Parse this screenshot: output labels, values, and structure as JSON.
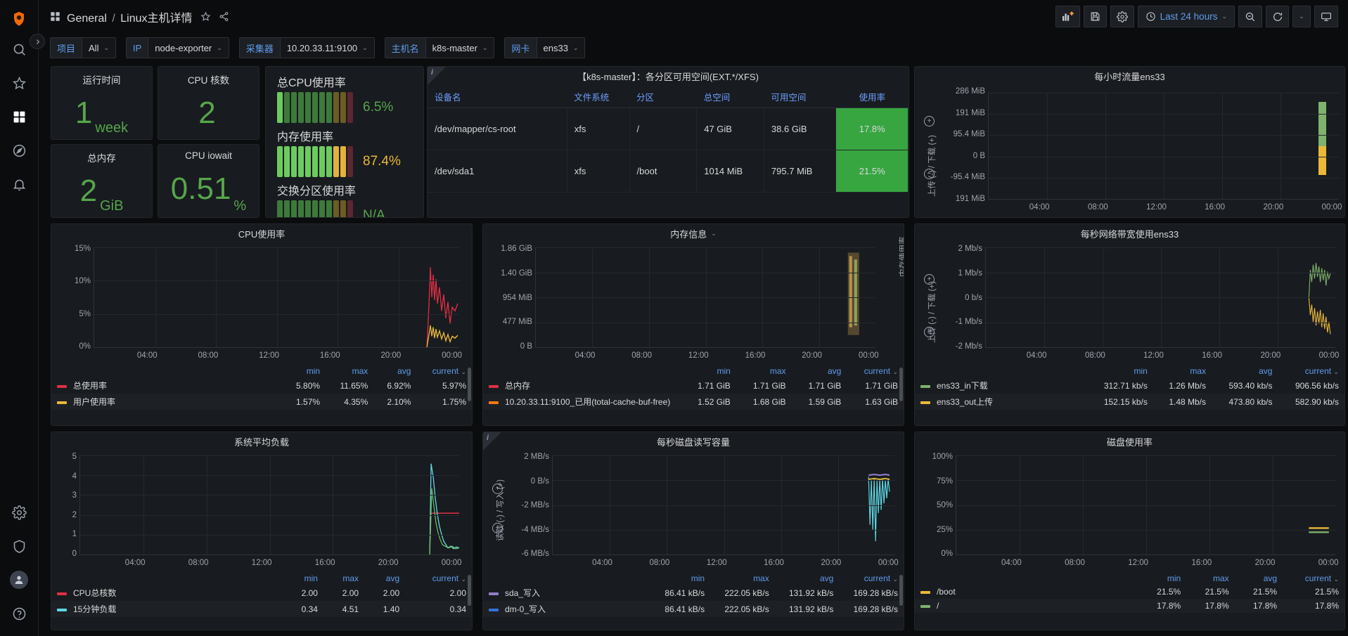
{
  "sidebar": {
    "logo_icon": "grafana-logo-icon",
    "expander_icon": "chevron-right-icon",
    "items": [
      {
        "name": "search-icon",
        "label": "Search"
      },
      {
        "name": "star-icon",
        "label": "Starred"
      },
      {
        "name": "dashboards-icon",
        "label": "Dashboards"
      },
      {
        "name": "compass-icon",
        "label": "Explore"
      },
      {
        "name": "bell-icon",
        "label": "Alerting"
      }
    ],
    "bottom_items": [
      {
        "name": "gear-icon",
        "label": "Configuration"
      },
      {
        "name": "shield-icon",
        "label": "Server Admin"
      },
      {
        "name": "avatar-icon",
        "label": "Profile"
      },
      {
        "name": "help-icon",
        "label": "Help"
      }
    ]
  },
  "topbar": {
    "dashboard_icon": "dashboard-grid-icon",
    "folder": "General",
    "separator": "/",
    "title": "Linux主机详情",
    "star_icon": "star-outline-icon",
    "share_icon": "share-nodes-icon",
    "actions": [
      {
        "name": "add-panel-button",
        "icon": "add-panel-icon"
      },
      {
        "name": "save-dashboard-button",
        "icon": "save-disk-icon"
      },
      {
        "name": "dashboard-settings-button",
        "icon": "gear-icon"
      }
    ],
    "time_picker": {
      "icon": "clock-icon",
      "label": "Last 24 hours",
      "caret": "⌄"
    },
    "zoom_out": {
      "name": "zoom-out-button",
      "icon": "magnifier-minus-icon"
    },
    "refresh": {
      "name": "refresh-button",
      "icon": "refresh-icon",
      "caret": "⌄"
    },
    "tv_mode": {
      "name": "tv-mode-button",
      "icon": "monitor-icon"
    }
  },
  "variables": [
    {
      "label": "项目",
      "value": "All",
      "caret": "⌄"
    },
    {
      "label": "IP",
      "value": "node-exporter",
      "caret": "⌄"
    },
    {
      "label": "采集器",
      "value": "10.20.33.11:9100",
      "caret": "⌄"
    },
    {
      "label": "主机名",
      "value": "k8s-master",
      "caret": "⌄"
    },
    {
      "label": "网卡",
      "value": "ens33",
      "caret": "⌄"
    }
  ],
  "stats": [
    {
      "title": "运行时间",
      "value": "1",
      "unit": "week",
      "color": "#56a64b"
    },
    {
      "title": "CPU 核数",
      "value": "2",
      "unit": "",
      "color": "#56a64b"
    },
    {
      "title": "总内存",
      "value": "2",
      "unit": "GiB",
      "color": "#56a64b"
    },
    {
      "title": "CPU iowait",
      "value": "0.51",
      "unit": "%",
      "color": "#56a64b"
    }
  ],
  "bargauges": {
    "rows": [
      {
        "label": "总CPU使用率",
        "value": "6.5%",
        "value_color": "#56a64b",
        "filled": 1,
        "total": 11
      },
      {
        "label": "内存使用率",
        "value": "87.4%",
        "value_color": "#eab839",
        "filled": 10,
        "total": 11
      },
      {
        "label": "交换分区使用率",
        "value": "N/A",
        "value_color": "#56a64b",
        "filled": 0,
        "total": 11
      }
    ]
  },
  "disk_table": {
    "title": "【k8s-master】：各分区可用空间(EXT.*/XFS)",
    "info_icon": "info-icon",
    "columns": [
      "设备名",
      "文件系统",
      "分区",
      "总空间",
      "可用空间",
      "使用率"
    ],
    "rows": [
      {
        "device": "/dev/mapper/cs-root",
        "fs": "xfs",
        "mount": "/",
        "total": "47 GiB",
        "avail": "38.6 GiB",
        "avail_state": "ok",
        "usage": "17.8%"
      },
      {
        "device": "/dev/sda1",
        "fs": "xfs",
        "mount": "/boot",
        "total": "1014 MiB",
        "avail": "795.7 MiB",
        "avail_state": "crit",
        "usage": "21.5%"
      }
    ]
  },
  "panels": {
    "cpu_usage": {
      "title": "CPU使用率",
      "y_ticks": [
        "15%",
        "10%",
        "5%",
        "0%"
      ],
      "x_ticks": [
        "04:00",
        "08:00",
        "12:00",
        "16:00",
        "20:00",
        "00:00"
      ],
      "legend_headers": [
        "min",
        "max",
        "avg",
        "current"
      ],
      "legend_sort_caret": "⌄",
      "series": [
        {
          "name": "总使用率",
          "color": "#e02f44",
          "min": "5.80%",
          "max": "11.65%",
          "avg": "6.92%",
          "current": "5.97%"
        },
        {
          "name": "用户使用率",
          "color": "#eab839",
          "min": "1.57%",
          "max": "4.35%",
          "avg": "2.10%",
          "current": "1.75%"
        }
      ]
    },
    "memory_info": {
      "title": "内存信息",
      "menu_caret": "⌄",
      "y_ticks": [
        "1.86 GiB",
        "1.40 GiB",
        "954 MiB",
        "477 MiB",
        "0 B"
      ],
      "x_ticks": [
        "04:00",
        "08:00",
        "12:00",
        "16:00",
        "20:00",
        "00:00"
      ],
      "right_label": "内存使用率",
      "legend_headers": [
        "min",
        "max",
        "avg",
        "current"
      ],
      "legend_sort_caret": "⌄",
      "series": [
        {
          "name": "总内存",
          "color": "#e02f44",
          "min": "1.71 GiB",
          "max": "1.71 GiB",
          "avg": "1.71 GiB",
          "current": "1.71 GiB"
        },
        {
          "name": "10.20.33.11:9100_已用(total-cache-buf-free)",
          "color": "#ff780a",
          "min": "1.52 GiB",
          "max": "1.68 GiB",
          "avg": "1.59 GiB",
          "current": "1.63 GiB"
        }
      ]
    },
    "hourly_traffic": {
      "title": "每小时流量ens33",
      "y_ticks": [
        "286 MiB",
        "191 MiB",
        "95.4 MiB",
        "0 B",
        "-95.4 MiB",
        "191 MiB"
      ],
      "x_ticks": [
        "04:00",
        "08:00",
        "12:00",
        "16:00",
        "20:00",
        "00:00"
      ],
      "y_axis_label": "上传 (-) / 下载 (+)",
      "bars": [
        {
          "up": "green",
          "down": "orange"
        }
      ]
    },
    "net_bandwidth": {
      "title": "每秒网络带宽使用ens33",
      "y_ticks": [
        "2 Mb/s",
        "1 Mb/s",
        "0 b/s",
        "-1 Mb/s",
        "-2 Mb/s"
      ],
      "x_ticks": [
        "04:00",
        "08:00",
        "12:00",
        "16:00",
        "20:00",
        "00:00"
      ],
      "y_axis_label": "上传 (-) / 下载 (+)",
      "legend_headers": [
        "min",
        "max",
        "avg",
        "current"
      ],
      "legend_sort_caret": "⌄",
      "series": [
        {
          "name": "ens33_in下载",
          "color": "#7eb26d",
          "min": "312.71 kb/s",
          "max": "1.26 Mb/s",
          "avg": "593.40 kb/s",
          "current": "906.56 kb/s"
        },
        {
          "name": "ens33_out上传",
          "color": "#eab839",
          "min": "152.15 kb/s",
          "max": "1.48 Mb/s",
          "avg": "473.80 kb/s",
          "current": "582.90 kb/s"
        }
      ]
    },
    "load_average": {
      "title": "系统平均负载",
      "y_ticks": [
        "5",
        "4",
        "3",
        "2",
        "1",
        "0"
      ],
      "x_ticks": [
        "04:00",
        "08:00",
        "12:00",
        "16:00",
        "20:00",
        "00:00"
      ],
      "legend_headers": [
        "min",
        "max",
        "avg",
        "current"
      ],
      "legend_sort_caret": "⌄",
      "series": [
        {
          "name": "CPU总核数",
          "color": "#e02f44",
          "min": "2.00",
          "max": "2.00",
          "avg": "2.00",
          "current": "2.00"
        },
        {
          "name": "15分钟负载",
          "color": "#5fd7e4",
          "min": "0.34",
          "max": "4.51",
          "avg": "1.40",
          "current": "0.34"
        }
      ]
    },
    "disk_io": {
      "title": "每秒磁盘读写容量",
      "info_icon": "info-icon",
      "y_ticks": [
        "2 MB/s",
        "0 B/s",
        "-2 MB/s",
        "-4 MB/s",
        "-6 MB/s"
      ],
      "x_ticks": [
        "04:00",
        "08:00",
        "12:00",
        "16:00",
        "20:00",
        "00:00"
      ],
      "y_axis_label": "读取 (-) / 写入 (+)",
      "legend_headers": [
        "min",
        "max",
        "avg",
        "current"
      ],
      "legend_sort_caret": "⌄",
      "series": [
        {
          "name": "sda_写入",
          "color": "#8f7ec9",
          "min": "86.41 kB/s",
          "max": "222.05 kB/s",
          "avg": "131.92 kB/s",
          "current": "169.28 kB/s"
        },
        {
          "name": "dm-0_写入",
          "color": "#3274d9",
          "min": "86.41 kB/s",
          "max": "222.05 kB/s",
          "avg": "131.92 kB/s",
          "current": "169.28 kB/s"
        }
      ]
    },
    "disk_usage": {
      "title": "磁盘使用率",
      "y_ticks": [
        "100%",
        "75%",
        "50%",
        "25%",
        "0%"
      ],
      "x_ticks": [
        "04:00",
        "08:00",
        "12:00",
        "16:00",
        "20:00",
        "00:00"
      ],
      "legend_headers": [
        "min",
        "max",
        "avg",
        "current"
      ],
      "legend_sort_caret": "⌄",
      "series": [
        {
          "name": "/boot",
          "color": "#eab839",
          "min": "21.5%",
          "max": "21.5%",
          "avg": "21.5%",
          "current": "21.5%"
        },
        {
          "name": "/",
          "color": "#7eb26d",
          "min": "17.8%",
          "max": "17.8%",
          "avg": "17.8%",
          "current": "17.8%"
        }
      ]
    }
  }
}
